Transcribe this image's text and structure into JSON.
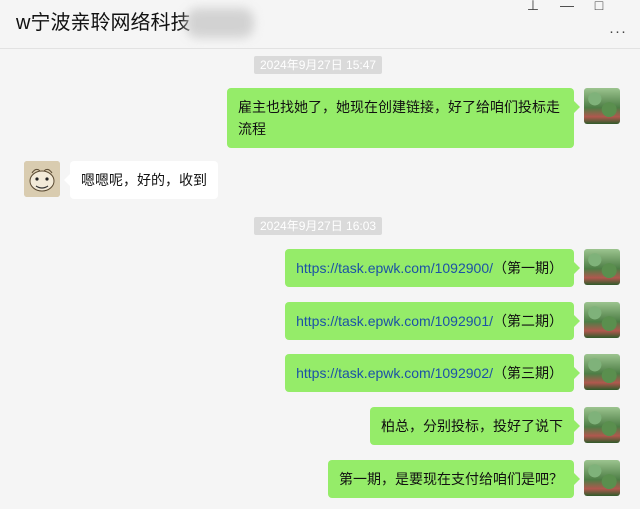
{
  "window": {
    "title": "w宁波亲聆网络科技",
    "pin_icon": "pin-icon",
    "minimize_icon": "minimize-icon",
    "maximize_icon": "maximize-icon",
    "more_icon": "more-options-icon"
  },
  "messages": [
    {
      "type": "timestamp",
      "text": "2024年9月27日 15:47"
    },
    {
      "type": "message",
      "sender": "me",
      "text": "雇主也找她了，她现在创建链接，好了给咱们投标走流程"
    },
    {
      "type": "message",
      "sender": "friend",
      "text": "嗯嗯呢，好的，收到"
    },
    {
      "type": "timestamp",
      "text": "2024年9月27日 16:03"
    },
    {
      "type": "message",
      "sender": "me",
      "link": "https://task.epwk.com/1092900/",
      "suffix": "（第一期）"
    },
    {
      "type": "message",
      "sender": "me",
      "link": "https://task.epwk.com/1092901/",
      "suffix": "（第二期）"
    },
    {
      "type": "message",
      "sender": "me",
      "link": "https://task.epwk.com/1092902/",
      "suffix": "（第三期）"
    },
    {
      "type": "message",
      "sender": "me",
      "text": "柏总，分别投标，投好了说下"
    },
    {
      "type": "message",
      "sender": "me",
      "text": "第一期，是要现在支付给咱们是吧？"
    }
  ]
}
